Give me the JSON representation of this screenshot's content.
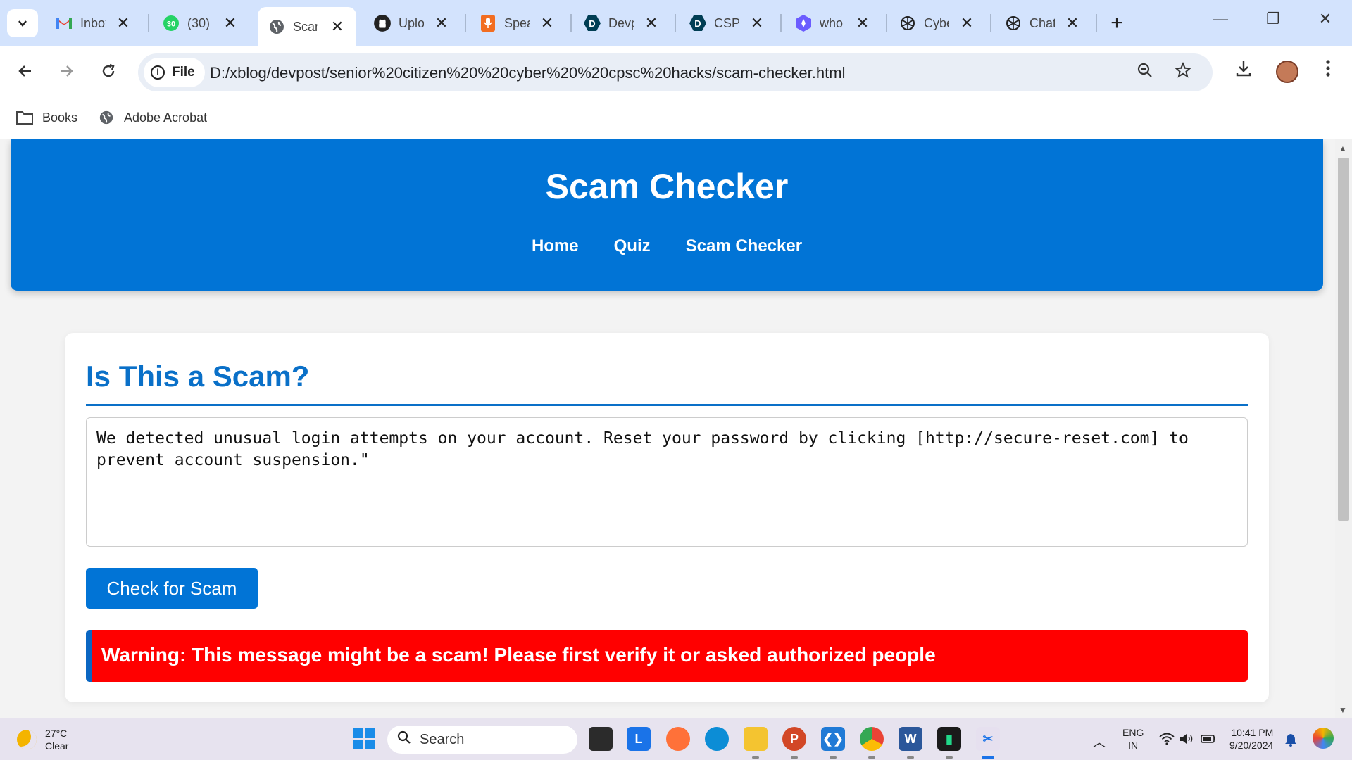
{
  "browser": {
    "tabs": [
      {
        "title": "Inbox",
        "icon": "gmail-icon",
        "color": "#ea4335"
      },
      {
        "title": "(30)",
        "icon": "whatsapp-icon",
        "color": "#25d366"
      },
      {
        "title": "Scam Checker",
        "icon": "globe-icon",
        "color": "#5f6368",
        "active": true
      },
      {
        "title": "Upload",
        "icon": "github-icon",
        "color": "#222222"
      },
      {
        "title": "Speak",
        "icon": "microphone-icon",
        "color": "#f26d21"
      },
      {
        "title": "Devpost",
        "icon": "devpost-icon",
        "color": "#003e54"
      },
      {
        "title": "CSPC",
        "icon": "devpost-icon",
        "color": "#003e54"
      },
      {
        "title": "who",
        "icon": "gemini-icon",
        "color": "#6b5cff"
      },
      {
        "title": "Cyber",
        "icon": "chatgpt-icon",
        "color": "#222222"
      },
      {
        "title": "ChatGPT",
        "icon": "chatgpt-icon",
        "color": "#222222"
      }
    ],
    "address": {
      "scheme_label": "File",
      "url": "D:/xblog/devpost/senior%20citizen%20%20cyber%20%20cpsc%20hacks/scam-checker.html"
    },
    "bookmarks": [
      {
        "label": "Books",
        "icon": "folder-icon"
      },
      {
        "label": "Adobe Acrobat",
        "icon": "globe-icon"
      }
    ]
  },
  "page": {
    "header": {
      "title": "Scam Checker",
      "nav": [
        "Home",
        "Quiz",
        "Scam Checker"
      ],
      "bg_color": "#0174d6"
    },
    "checker": {
      "heading": "Is This a Scam?",
      "message": "We detected unusual login attempts on your account. Reset your password by clicking [http://secure-reset.com] to prevent account suspension.\"",
      "button_label": "Check for Scam",
      "result": "Warning: This message might be a scam! Please first verify it or asked authorized people",
      "result_color": "#ff0000"
    }
  },
  "taskbar": {
    "weather": {
      "temp": "27°C",
      "condition": "Clear"
    },
    "search_placeholder": "Search",
    "apps": [
      "file-explorer-icon",
      "launcher-icon",
      "firefox-icon",
      "edge-icon",
      "folder-icon",
      "powerpoint-icon",
      "vscode-icon",
      "chrome-icon",
      "word-icon",
      "pycharm-icon",
      "snipping-tool-icon"
    ],
    "tray": {
      "lang_line1": "ENG",
      "lang_line2": "IN",
      "time": "10:41 PM",
      "date": "9/20/2024"
    }
  }
}
